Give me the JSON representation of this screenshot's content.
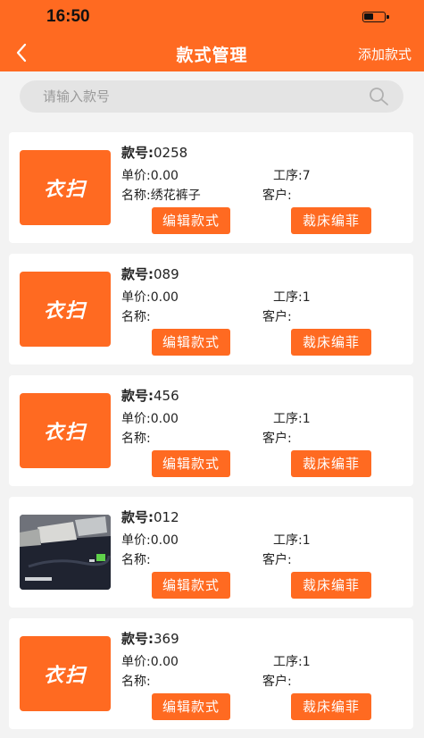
{
  "status_bar": {
    "time": "16:50"
  },
  "header": {
    "back_icon": "chevron-left-icon",
    "title": "款式管理",
    "action_label": "添加款式"
  },
  "search": {
    "placeholder": "请输入款号",
    "icon": "search-icon"
  },
  "labels": {
    "style_no": "款号:",
    "unit_price": "单价:",
    "process": "工序:",
    "name": "名称:",
    "customer": "客户:",
    "edit_button": "编辑款式",
    "cut_button": "裁床编菲"
  },
  "logo_text": "衣扫",
  "colors": {
    "accent": "#ff6a21",
    "background": "#f3f3f3"
  },
  "styles": [
    {
      "style_no": "0258",
      "unit_price": "0.00",
      "process": "7",
      "name": "绣花裤子",
      "customer": "",
      "image": "logo"
    },
    {
      "style_no": "089",
      "unit_price": "0.00",
      "process": "1",
      "name": "",
      "customer": "",
      "image": "logo"
    },
    {
      "style_no": "456",
      "unit_price": "0.00",
      "process": "1",
      "name": "",
      "customer": "",
      "image": "logo"
    },
    {
      "style_no": "012",
      "unit_price": "0.00",
      "process": "1",
      "name": "",
      "customer": "",
      "image": "photo"
    },
    {
      "style_no": "369",
      "unit_price": "0.00",
      "process": "1",
      "name": "",
      "customer": "",
      "image": "logo"
    }
  ]
}
